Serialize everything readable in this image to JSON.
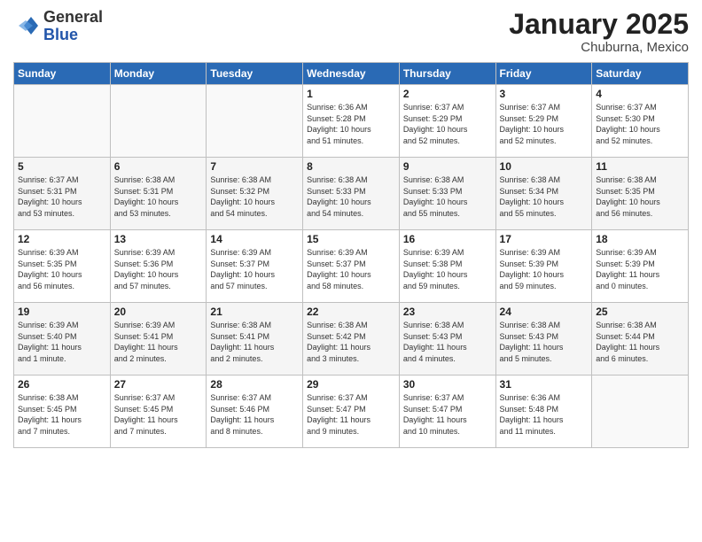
{
  "header": {
    "logo_line1": "General",
    "logo_line2": "Blue",
    "title": "January 2025",
    "subtitle": "Chuburna, Mexico"
  },
  "days_of_week": [
    "Sunday",
    "Monday",
    "Tuesday",
    "Wednesday",
    "Thursday",
    "Friday",
    "Saturday"
  ],
  "weeks": [
    [
      {
        "num": "",
        "info": ""
      },
      {
        "num": "",
        "info": ""
      },
      {
        "num": "",
        "info": ""
      },
      {
        "num": "1",
        "info": "Sunrise: 6:36 AM\nSunset: 5:28 PM\nDaylight: 10 hours\nand 51 minutes."
      },
      {
        "num": "2",
        "info": "Sunrise: 6:37 AM\nSunset: 5:29 PM\nDaylight: 10 hours\nand 52 minutes."
      },
      {
        "num": "3",
        "info": "Sunrise: 6:37 AM\nSunset: 5:29 PM\nDaylight: 10 hours\nand 52 minutes."
      },
      {
        "num": "4",
        "info": "Sunrise: 6:37 AM\nSunset: 5:30 PM\nDaylight: 10 hours\nand 52 minutes."
      }
    ],
    [
      {
        "num": "5",
        "info": "Sunrise: 6:37 AM\nSunset: 5:31 PM\nDaylight: 10 hours\nand 53 minutes."
      },
      {
        "num": "6",
        "info": "Sunrise: 6:38 AM\nSunset: 5:31 PM\nDaylight: 10 hours\nand 53 minutes."
      },
      {
        "num": "7",
        "info": "Sunrise: 6:38 AM\nSunset: 5:32 PM\nDaylight: 10 hours\nand 54 minutes."
      },
      {
        "num": "8",
        "info": "Sunrise: 6:38 AM\nSunset: 5:33 PM\nDaylight: 10 hours\nand 54 minutes."
      },
      {
        "num": "9",
        "info": "Sunrise: 6:38 AM\nSunset: 5:33 PM\nDaylight: 10 hours\nand 55 minutes."
      },
      {
        "num": "10",
        "info": "Sunrise: 6:38 AM\nSunset: 5:34 PM\nDaylight: 10 hours\nand 55 minutes."
      },
      {
        "num": "11",
        "info": "Sunrise: 6:38 AM\nSunset: 5:35 PM\nDaylight: 10 hours\nand 56 minutes."
      }
    ],
    [
      {
        "num": "12",
        "info": "Sunrise: 6:39 AM\nSunset: 5:35 PM\nDaylight: 10 hours\nand 56 minutes."
      },
      {
        "num": "13",
        "info": "Sunrise: 6:39 AM\nSunset: 5:36 PM\nDaylight: 10 hours\nand 57 minutes."
      },
      {
        "num": "14",
        "info": "Sunrise: 6:39 AM\nSunset: 5:37 PM\nDaylight: 10 hours\nand 57 minutes."
      },
      {
        "num": "15",
        "info": "Sunrise: 6:39 AM\nSunset: 5:37 PM\nDaylight: 10 hours\nand 58 minutes."
      },
      {
        "num": "16",
        "info": "Sunrise: 6:39 AM\nSunset: 5:38 PM\nDaylight: 10 hours\nand 59 minutes."
      },
      {
        "num": "17",
        "info": "Sunrise: 6:39 AM\nSunset: 5:39 PM\nDaylight: 10 hours\nand 59 minutes."
      },
      {
        "num": "18",
        "info": "Sunrise: 6:39 AM\nSunset: 5:39 PM\nDaylight: 11 hours\nand 0 minutes."
      }
    ],
    [
      {
        "num": "19",
        "info": "Sunrise: 6:39 AM\nSunset: 5:40 PM\nDaylight: 11 hours\nand 1 minute."
      },
      {
        "num": "20",
        "info": "Sunrise: 6:39 AM\nSunset: 5:41 PM\nDaylight: 11 hours\nand 2 minutes."
      },
      {
        "num": "21",
        "info": "Sunrise: 6:38 AM\nSunset: 5:41 PM\nDaylight: 11 hours\nand 2 minutes."
      },
      {
        "num": "22",
        "info": "Sunrise: 6:38 AM\nSunset: 5:42 PM\nDaylight: 11 hours\nand 3 minutes."
      },
      {
        "num": "23",
        "info": "Sunrise: 6:38 AM\nSunset: 5:43 PM\nDaylight: 11 hours\nand 4 minutes."
      },
      {
        "num": "24",
        "info": "Sunrise: 6:38 AM\nSunset: 5:43 PM\nDaylight: 11 hours\nand 5 minutes."
      },
      {
        "num": "25",
        "info": "Sunrise: 6:38 AM\nSunset: 5:44 PM\nDaylight: 11 hours\nand 6 minutes."
      }
    ],
    [
      {
        "num": "26",
        "info": "Sunrise: 6:38 AM\nSunset: 5:45 PM\nDaylight: 11 hours\nand 7 minutes."
      },
      {
        "num": "27",
        "info": "Sunrise: 6:37 AM\nSunset: 5:45 PM\nDaylight: 11 hours\nand 7 minutes."
      },
      {
        "num": "28",
        "info": "Sunrise: 6:37 AM\nSunset: 5:46 PM\nDaylight: 11 hours\nand 8 minutes."
      },
      {
        "num": "29",
        "info": "Sunrise: 6:37 AM\nSunset: 5:47 PM\nDaylight: 11 hours\nand 9 minutes."
      },
      {
        "num": "30",
        "info": "Sunrise: 6:37 AM\nSunset: 5:47 PM\nDaylight: 11 hours\nand 10 minutes."
      },
      {
        "num": "31",
        "info": "Sunrise: 6:36 AM\nSunset: 5:48 PM\nDaylight: 11 hours\nand 11 minutes."
      },
      {
        "num": "",
        "info": ""
      }
    ]
  ]
}
